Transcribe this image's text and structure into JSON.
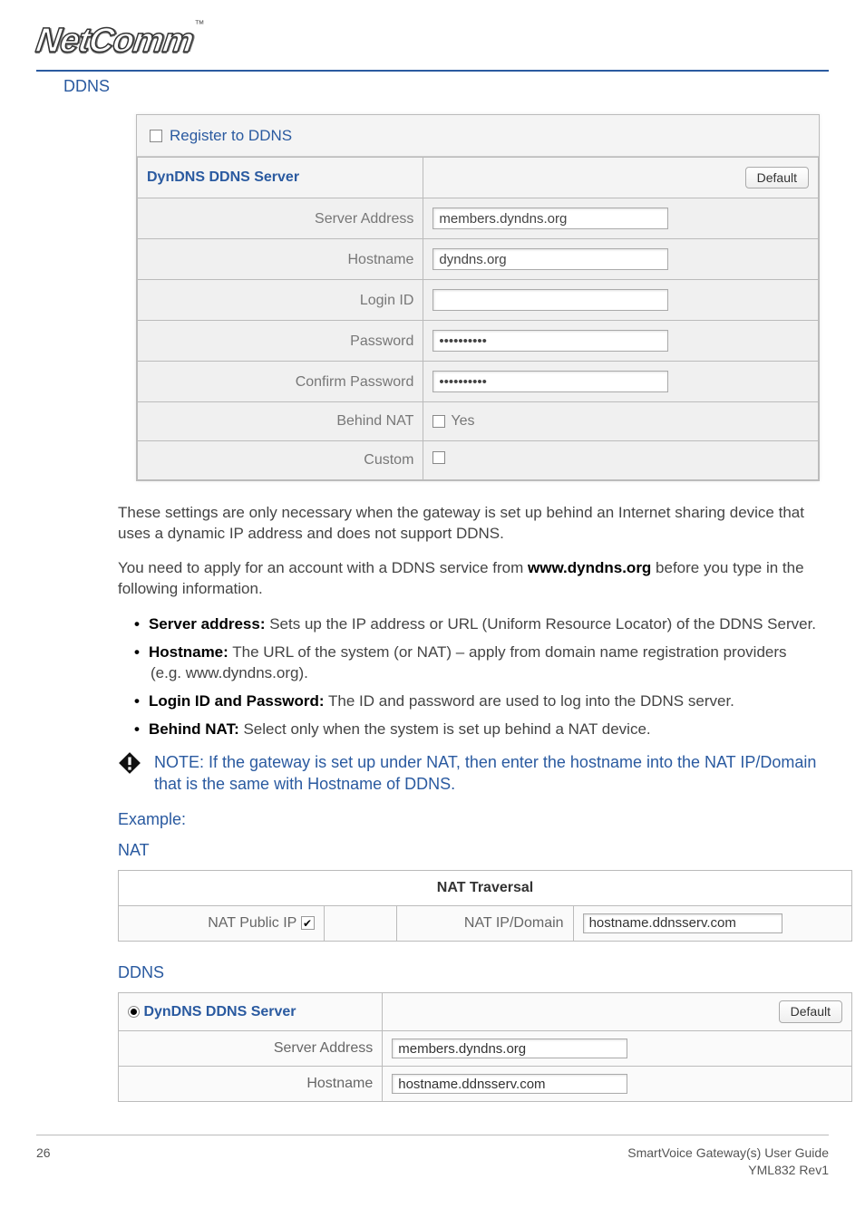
{
  "brand": {
    "name": "NetComm",
    "tm": "™"
  },
  "heading": "DDNS",
  "panel": {
    "register": "Register to DDNS",
    "serverTitle": "DynDNS DDNS Server",
    "defaultBtn": "Default",
    "rows": {
      "serverAddressLabel": "Server Address",
      "serverAddressValue": "members.dyndns.org",
      "hostnameLabel": "Hostname",
      "hostnameValue": "dyndns.org",
      "loginLabel": "Login ID",
      "loginValue": "",
      "passwordLabel": "Password",
      "passwordValue": "••••••••••",
      "confirmLabel": "Confirm Password",
      "confirmValue": "••••••••••",
      "behindNatLabel": "Behind NAT",
      "behindNatText": "Yes",
      "customLabel": "Custom"
    }
  },
  "body": {
    "p1": "These settings are only necessary when the gateway is set up behind an Internet sharing device that uses a dynamic IP address and does not support DDNS.",
    "p2a": "You need to apply for an account with a DDNS service from ",
    "p2b": "www.dyndns.org",
    "p2c": " before you type in the following information.",
    "b1a": "Server address:",
    "b1b": " Sets up the IP address or URL (Uniform Resource Locator) of the DDNS Server.",
    "b2a": "Hostname:",
    "b2b": " The URL of the system (or NAT) – apply from domain name registration providers (e.g. www.dyndns.org).",
    "b3a": "Login ID and Password:",
    "b3b": " The ID and password are used to log into the DDNS server.",
    "b4a": "Behind NAT:",
    "b4b": " Select only when the system is set up behind a NAT device."
  },
  "note": {
    "head": "NOTE: ",
    "text": "If the gateway is set up under NAT, then enter the hostname into the NAT IP/Domain that is the same with Hostname of DDNS."
  },
  "example": "Example:",
  "natSection": {
    "head": "NAT",
    "tableTitle": "NAT Traversal",
    "publicLabel": "NAT Public IP",
    "ipDomainLabel": "NAT IP/Domain",
    "ipDomainValue": "hostname.ddnsserv.com"
  },
  "ddnsSection": {
    "head": "DDNS",
    "serverTitle": "DynDNS DDNS Server",
    "defaultBtn": "Default",
    "serverAddressLabel": "Server Address",
    "serverAddressValue": "members.dyndns.org",
    "hostnameLabel": "Hostname",
    "hostnameValue": "hostname.ddnsserv.com"
  },
  "footer": {
    "page": "26",
    "line1": "SmartVoice Gateway(s) User Guide",
    "line2": "YML832 Rev1"
  }
}
